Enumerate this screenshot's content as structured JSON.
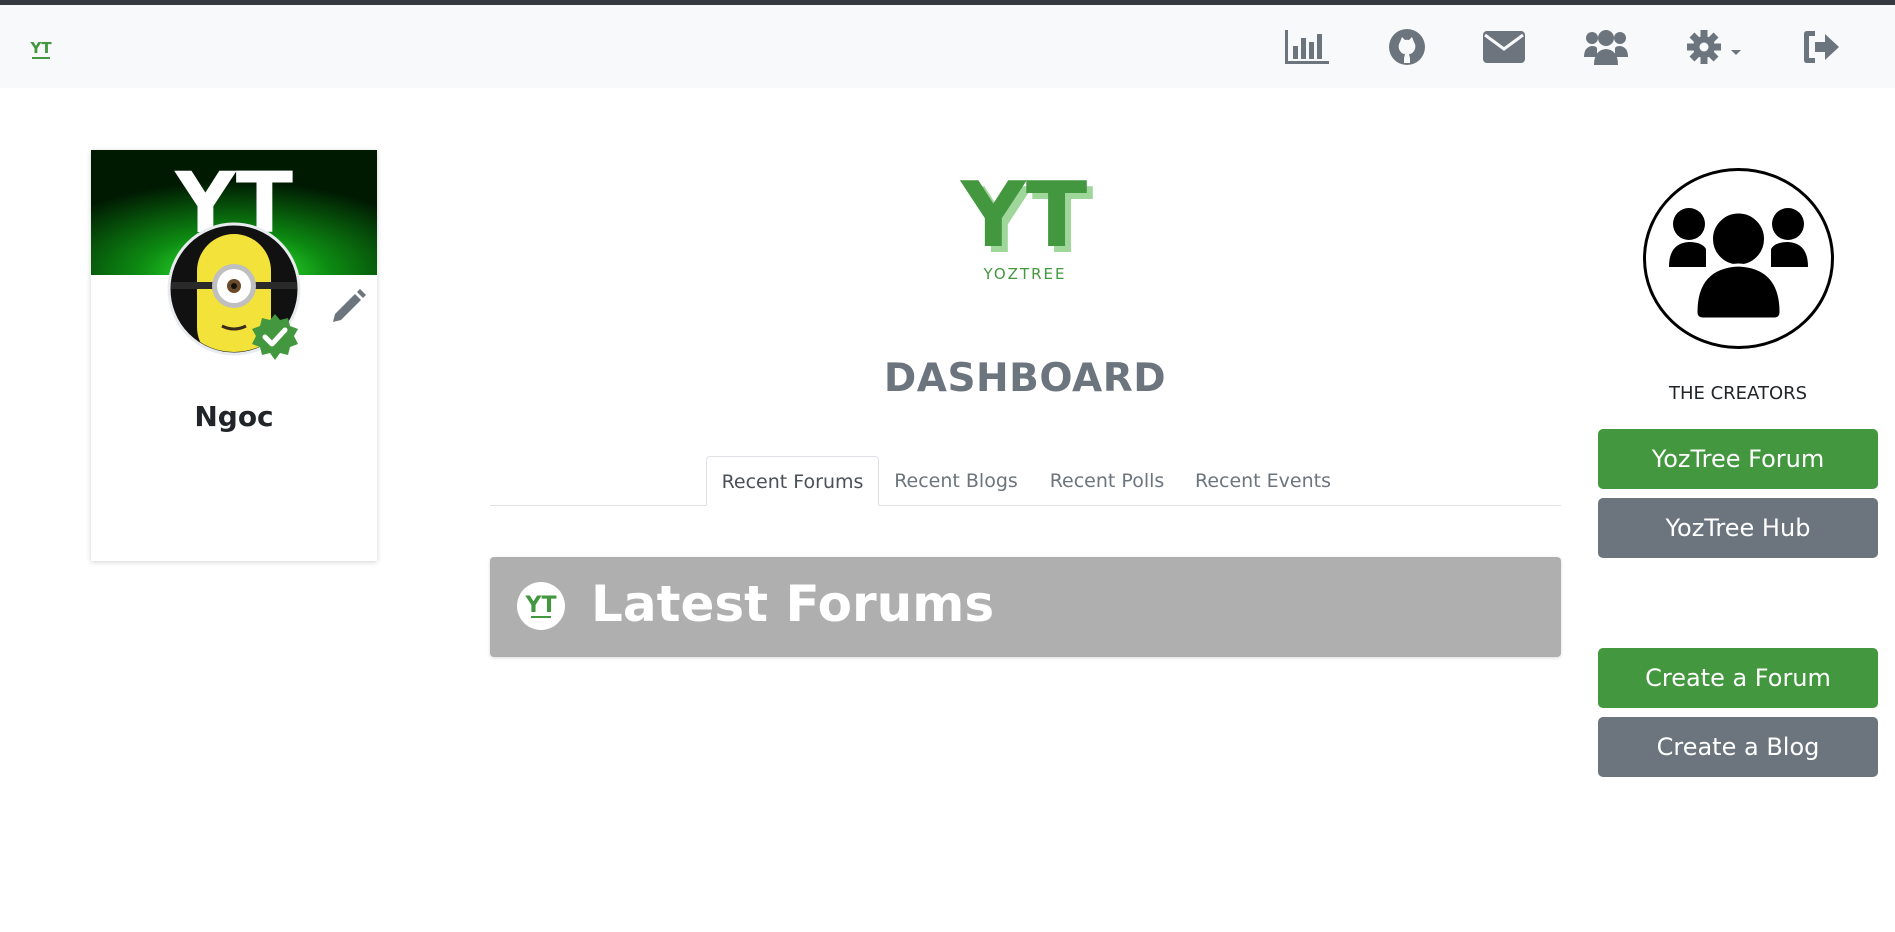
{
  "nav": {
    "brand": "YT",
    "icons": [
      "bar-chart-icon",
      "github-icon",
      "envelope-icon",
      "users-icon",
      "gear-icon",
      "sign-out-icon"
    ]
  },
  "profile": {
    "name": "Ngoc",
    "cover_logo": "YT"
  },
  "main": {
    "logo_letters": "YT",
    "logo_sub": "YOZTREE",
    "title": "DASHBOARD",
    "tabs": [
      {
        "label": "Recent Forums",
        "active": true
      },
      {
        "label": "Recent Blogs",
        "active": false
      },
      {
        "label": "Recent Polls",
        "active": false
      },
      {
        "label": "Recent Events",
        "active": false
      }
    ],
    "panel_title": "Latest Forums"
  },
  "sidebar": {
    "creators_label": "THE CREATORS",
    "buttons": {
      "forum": "YozTree Forum",
      "hub": "YozTree Hub",
      "create_forum": "Create a Forum",
      "create_blog": "Create a Blog"
    }
  },
  "colors": {
    "brand_green": "#43973e",
    "secondary_grey": "#6c757d",
    "panel_grey": "#afafaf"
  }
}
